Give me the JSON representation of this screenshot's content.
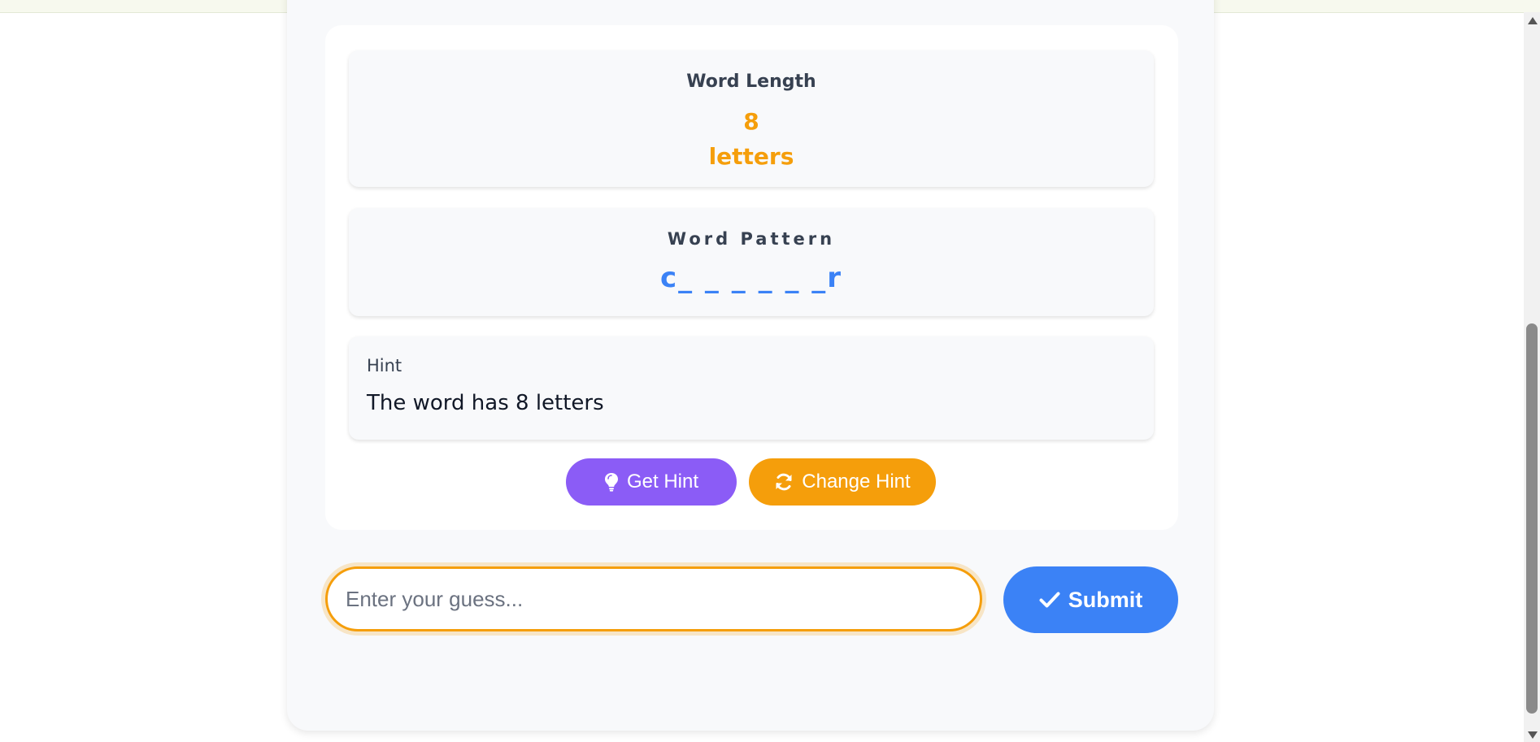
{
  "word_length": {
    "label": "Word Length",
    "number": "8",
    "unit": "letters"
  },
  "word_pattern": {
    "label": "Word Pattern",
    "value": "c_ _ _ _ _ _r"
  },
  "hint": {
    "label": "Hint",
    "text": "The word has 8 letters"
  },
  "buttons": {
    "get_hint": "Get Hint",
    "change_hint": "Change Hint",
    "submit": "Submit"
  },
  "guess": {
    "placeholder": "Enter your guess...",
    "value": ""
  },
  "icons": {
    "get_hint": "lightbulb-icon",
    "change_hint": "refresh-icon",
    "submit": "check-icon"
  },
  "colors": {
    "accent_orange": "#f59e0b",
    "pattern_blue": "#3b82f6",
    "hint_purple": "#8b5cf6"
  }
}
